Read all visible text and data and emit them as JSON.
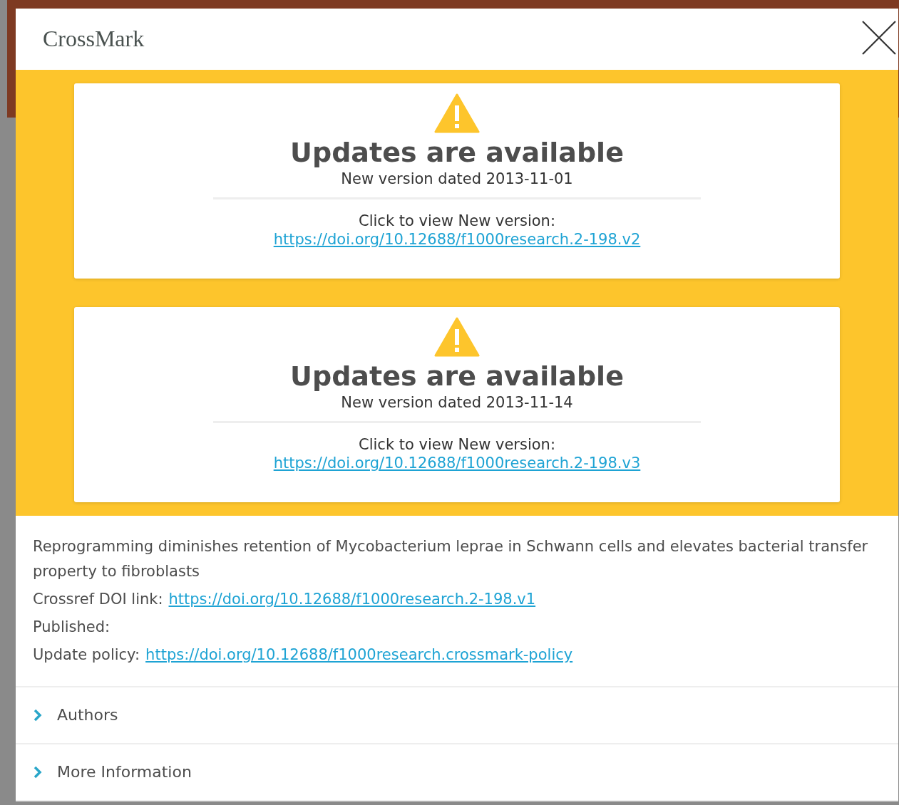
{
  "header": {
    "title": "CrossMark"
  },
  "updates": [
    {
      "title": "Updates are available",
      "date": "New version dated 2013-11-01",
      "prompt": "Click to view New version:",
      "link": "https://doi.org/10.12688/f1000research.2-198.v2"
    },
    {
      "title": "Updates are available",
      "date": "New version dated 2013-11-14",
      "prompt": "Click to view New version:",
      "link": "https://doi.org/10.12688/f1000research.2-198.v3"
    }
  ],
  "info": {
    "article_title": "Reprogramming diminishes retention of Mycobacterium leprae in Schwann cells and elevates bacterial transfer property to fibroblasts",
    "fields": [
      {
        "label": "Crossref DOI link:",
        "link": "https://doi.org/10.12688/f1000research.2-198.v1"
      },
      {
        "label": "Published:"
      },
      {
        "label": "Update policy:",
        "link": "https://doi.org/10.12688/f1000research.crossmark-policy"
      }
    ]
  },
  "sections": [
    {
      "label": "Authors",
      "expanded": false
    },
    {
      "label": "More Information",
      "expanded": false
    }
  ]
}
